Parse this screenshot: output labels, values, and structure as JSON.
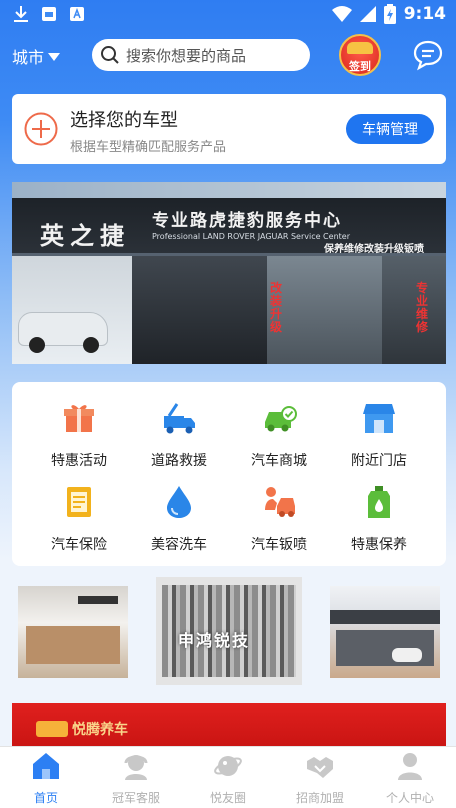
{
  "status_bar": {
    "time": "9:14",
    "icons": [
      "download-icon",
      "sim-card-icon",
      "text-icon",
      "wifi-icon",
      "signal-icon",
      "battery-icon"
    ]
  },
  "header": {
    "city_label": "城市",
    "search_placeholder": "搜索你想要的商品",
    "sign_in_label": "签到",
    "message_icon": "chat-bubble-icon"
  },
  "car_card": {
    "title": "选择您的车型",
    "subtitle": "根据车型精确匹配服务产品",
    "button_label": "车辆管理"
  },
  "banner": {
    "brand": "英之捷",
    "line1": "专业路虎捷豹服务中心",
    "line2": "Professional LAND ROVER JAGUAR Service Center",
    "line3": "保养维修改装升级钣喷",
    "red_left": "改装升级",
    "red_right": "专业维修"
  },
  "services": [
    {
      "label": "特惠活动",
      "icon": "gift-icon",
      "color": "#f2744a"
    },
    {
      "label": "道路救援",
      "icon": "tow-truck-icon",
      "color": "#2a86e8"
    },
    {
      "label": "汽车商城",
      "icon": "car-mall-icon",
      "color": "#5bbd3a"
    },
    {
      "label": "附近门店",
      "icon": "store-icon",
      "color": "#2a86e8"
    },
    {
      "label": "汽车保险",
      "icon": "insurance-icon",
      "color": "#f2b21c"
    },
    {
      "label": "美容洗车",
      "icon": "water-drop-icon",
      "color": "#2a86e8"
    },
    {
      "label": "汽车钣喷",
      "icon": "spray-repair-icon",
      "color": "#f2744a"
    },
    {
      "label": "特惠保养",
      "icon": "oil-bottle-icon",
      "color": "#5bbd3a"
    }
  ],
  "stores": {
    "middle_sign": "申鸿锐技"
  },
  "promo": {
    "text": "悦腾养车"
  },
  "tabs": [
    {
      "label": "首页",
      "icon": "home-icon",
      "active": true
    },
    {
      "label": "冠军客服",
      "icon": "customer-service-icon",
      "active": false
    },
    {
      "label": "悦友圈",
      "icon": "planet-icon",
      "active": false
    },
    {
      "label": "招商加盟",
      "icon": "handshake-icon",
      "active": false
    },
    {
      "label": "个人中心",
      "icon": "person-icon",
      "active": false
    }
  ],
  "colors": {
    "brand_blue": "#1f75f0",
    "tab_active": "#2c7ff3",
    "tab_inactive": "#b0b0b0",
    "promo_red": "#d8191a"
  }
}
